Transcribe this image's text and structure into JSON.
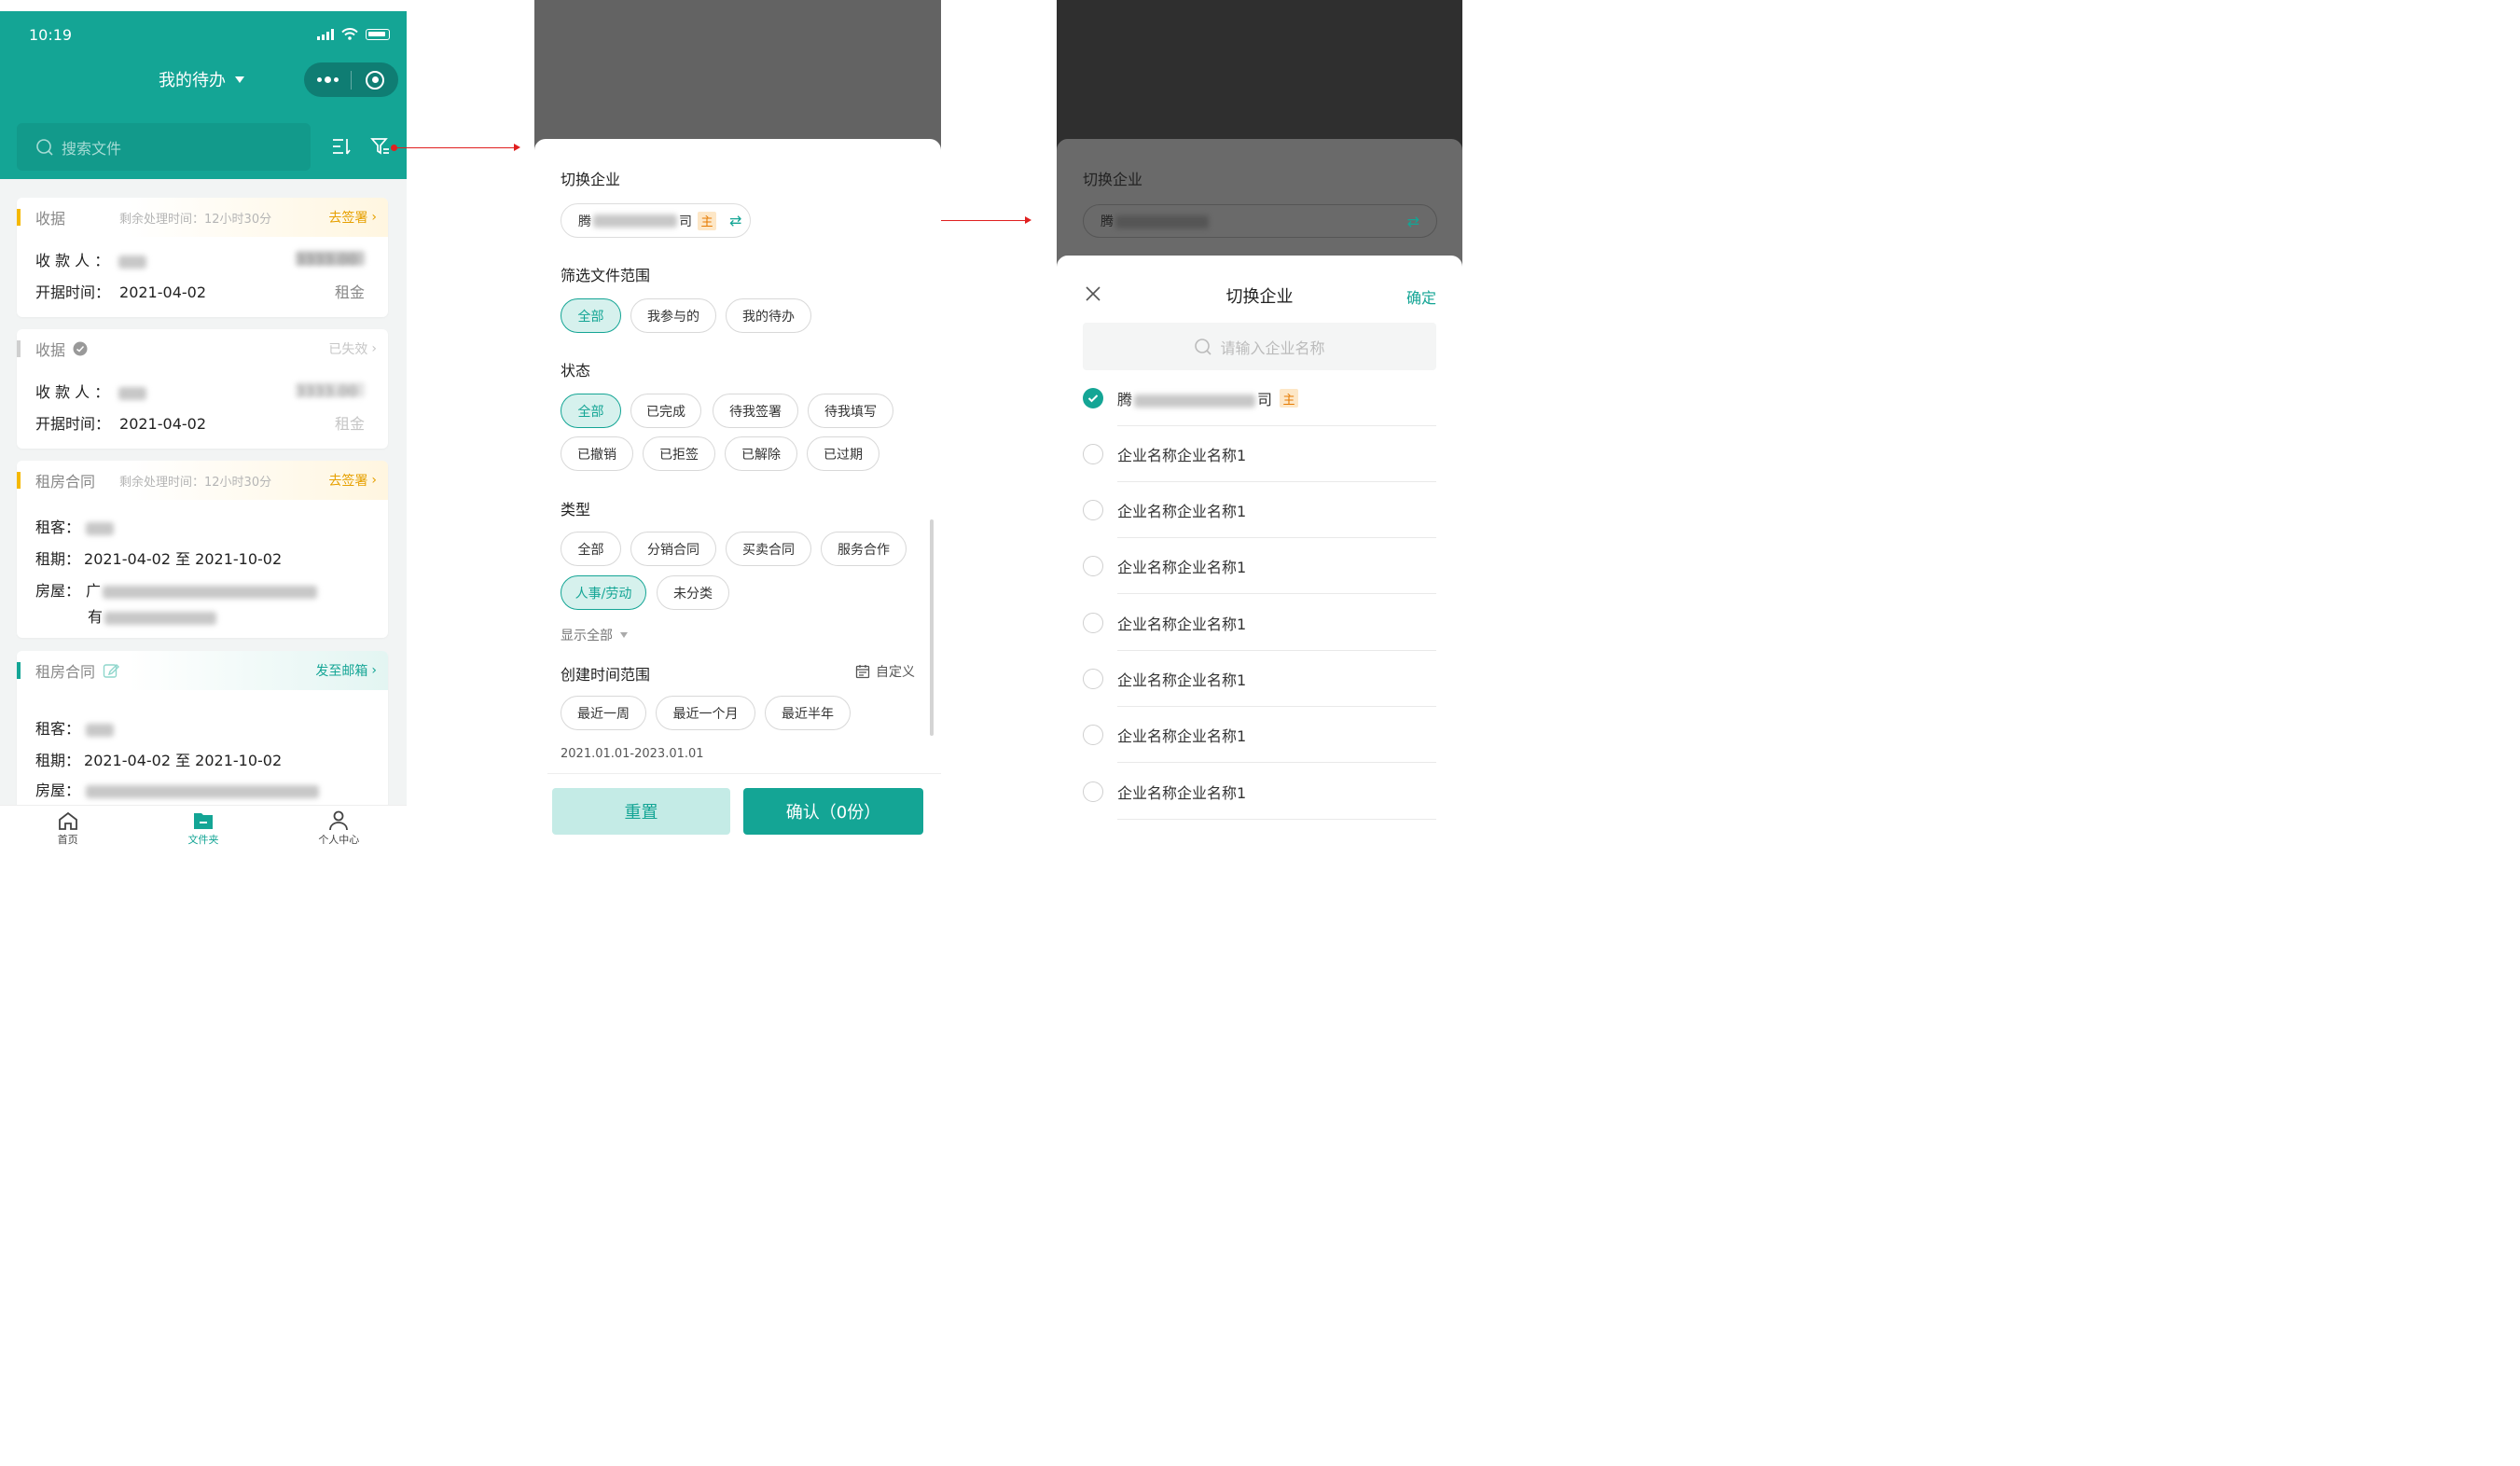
{
  "colors": {
    "primary": "#14a595",
    "warning": "#e6a000",
    "zhu_bg": "#fde7c7",
    "zhu_fg": "#e67a00"
  },
  "panel1": {
    "status_time": "10:19",
    "title": "我的待办",
    "search_placeholder": "搜索文件",
    "cards": [
      {
        "type": "收据",
        "remain": "剩余处理时间：12小时30分",
        "action": "去签署",
        "payee_label": "收 款 人 ：",
        "amount": "3333.00",
        "date_label": "开据时间：",
        "date": "2021-04-02",
        "category": "租金"
      },
      {
        "type": "收据",
        "action": "已失效",
        "payee_label": "收 款 人 ：",
        "amount": "3333.00",
        "date_label": "开据时间：",
        "date": "2021-04-02",
        "category": "租金"
      },
      {
        "type": "租房合同",
        "remain": "剩余处理时间：12小时30分",
        "action": "去签署",
        "tenant_label": "租客：",
        "term_label": "租期：",
        "term": "2021-04-02 至 2021-10-02",
        "house_label": "房屋：",
        "house_1": "广",
        "house_2": "有"
      },
      {
        "type": "租房合同",
        "action": "发至邮箱",
        "tenant_label": "租客：",
        "term_label": "租期：",
        "term": "2021-04-02 至 2021-10-02",
        "house_label": "房屋："
      }
    ],
    "tabs": [
      "首页",
      "文件夹",
      "个人中心"
    ]
  },
  "panel2": {
    "switch_title": "切换企业",
    "ent_prefix": "腾",
    "ent_suffix": "司",
    "zhu": "主",
    "scope_title": "筛选文件范围",
    "scope": [
      "全部",
      "我参与的",
      "我的待办"
    ],
    "status_title": "状态",
    "status": [
      "全部",
      "已完成",
      "待我签署",
      "待我填写",
      "已撤销",
      "已拒签",
      "已解除",
      "已过期"
    ],
    "type_title": "类型",
    "types": [
      "全部",
      "分销合同",
      "买卖合同",
      "服务合作",
      "人事/劳动",
      "未分类"
    ],
    "show_all": "显示全部",
    "time_title": "创建时间范围",
    "custom": "自定义",
    "times": [
      "最近一周",
      "最近一个月",
      "最近半年"
    ],
    "date_range": "2021.01.01-2023.01.01",
    "reset": "重置",
    "confirm": "确认（0份）"
  },
  "panel3": {
    "under_title": "切换企业",
    "under_ent_prefix": "腾",
    "modal_title": "切换企业",
    "confirm": "确定",
    "search_placeholder": "请输入企业名称",
    "first_prefix": "腾",
    "first_suffix": "司",
    "zhu": "主",
    "options": [
      "企业名称企业名称1",
      "企业名称企业名称1",
      "企业名称企业名称1",
      "企业名称企业名称1",
      "企业名称企业名称1",
      "企业名称企业名称1",
      "企业名称企业名称1"
    ]
  }
}
